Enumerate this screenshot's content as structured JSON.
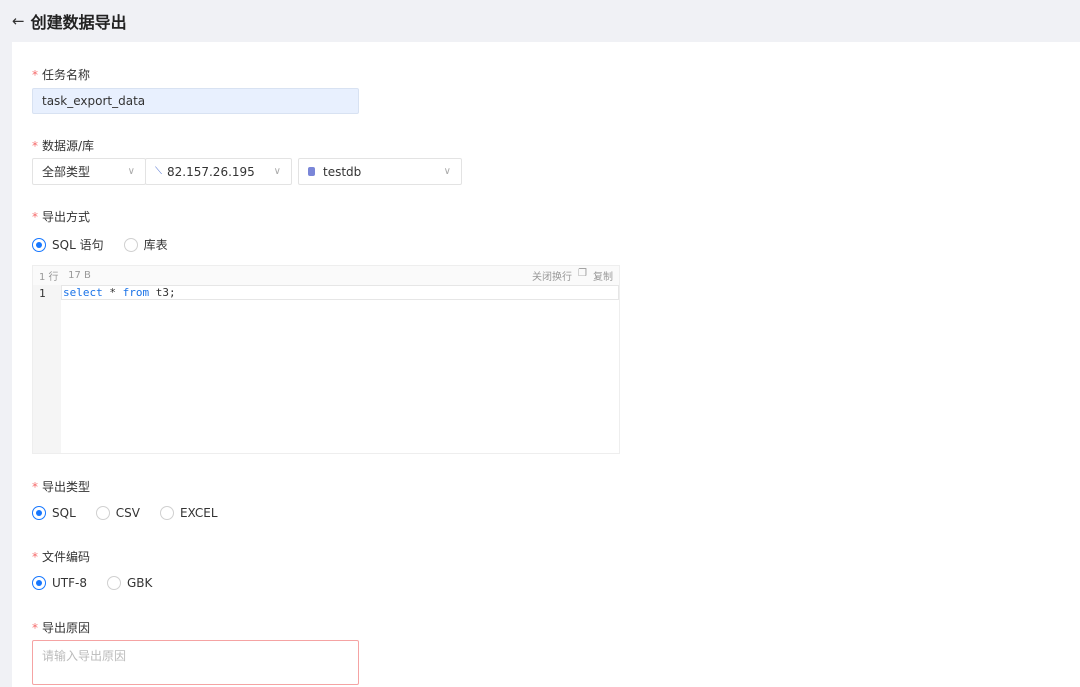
{
  "header": {
    "title": "创建数据导出",
    "back_icon": "arrow-left-icon"
  },
  "task_name": {
    "label": "任务名称",
    "value": "task_export_data"
  },
  "datasource": {
    "label": "数据源/库",
    "type": "全部类型",
    "host": "82.157.26.195",
    "database": "testdb"
  },
  "export_mode": {
    "label": "导出方式",
    "options": [
      "SQL 语句",
      "库表"
    ],
    "selected": 0
  },
  "editor": {
    "lines": "1 行",
    "size": "17 B",
    "wrap_toggle": "关闭换行",
    "copy": "复制",
    "line_number": "1",
    "code_kw1": "select",
    "code_mid": " * ",
    "code_kw2": "from",
    "code_rest": " t3;"
  },
  "export_type": {
    "label": "导出类型",
    "options": [
      "SQL",
      "CSV",
      "EXCEL"
    ],
    "selected": 0
  },
  "encoding": {
    "label": "文件编码",
    "options": [
      "UTF-8",
      "GBK"
    ],
    "selected": 0
  },
  "reason": {
    "label": "导出原因",
    "placeholder": "请输入导出原因"
  },
  "colors": {
    "accent": "#1677ff",
    "required": "#f56c6c"
  }
}
